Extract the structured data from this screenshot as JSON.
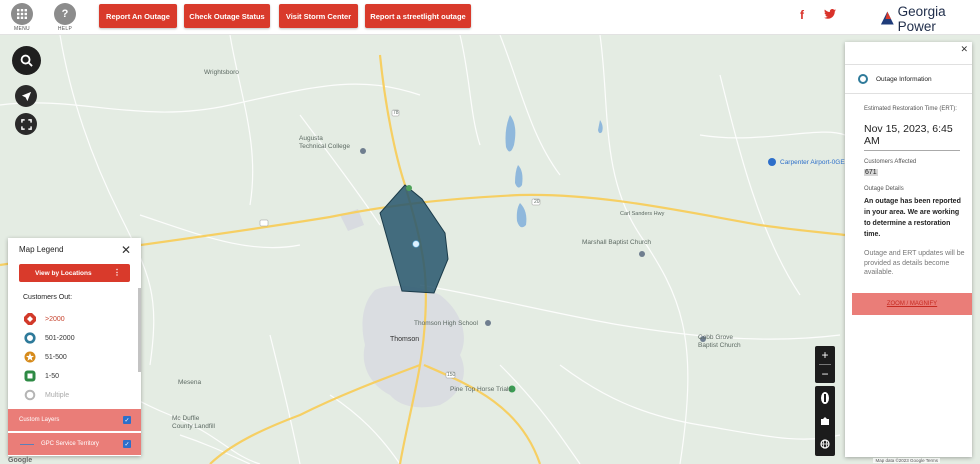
{
  "header": {
    "menu_label": "MENU",
    "help_label": "HELP",
    "buttons": [
      "Report An Outage",
      "Check Outage Status",
      "Visit Storm Center",
      "Report a streetlight outage"
    ],
    "social": [
      "f",
      "t"
    ],
    "brand": "Georgia Power",
    "brand_color": "#1f2d4a",
    "accent": "#d93a2b"
  },
  "map": {
    "labels": {
      "wrightsboro": "Wrightsboro",
      "augusta_tech": "Augusta\nTechnical College",
      "carpenter": "Carpenter Airport-0GE",
      "carl_sanders": "Carl Sanders Hwy",
      "marshall": "Marshall Baptist Church",
      "thomson_hs": "Thomson High School",
      "thomson": "Thomson",
      "pine_top": "Pine Top Horse Trials",
      "cobb_grove": "Cobb Grove\nBaptist Church",
      "mesena": "Mesena",
      "mcduffie": "Mc Duffie\nCounty Landfill",
      "hwy_78": "78",
      "hwy_20": "20",
      "hwy_150": "150"
    },
    "outage_color": "#2c5a70"
  },
  "legend": {
    "title": "Map Legend",
    "close": "✕",
    "view_button": "View by Locations",
    "customers_out": "Customers Out:",
    "items": [
      {
        "label": ">2000",
        "icon": "red-octagon-icon",
        "color": "#d23a2a"
      },
      {
        "label": "501-2000",
        "icon": "blue-ring-icon",
        "color": "#2e7a9a"
      },
      {
        "label": "51-500",
        "icon": "orange-star-icon",
        "color": "#d68a1a"
      },
      {
        "label": "1-50",
        "icon": "green-square-icon",
        "color": "#2e8a44"
      },
      {
        "label": "Multiple",
        "icon": "grey-ring-icon",
        "color": "#b5b5b5"
      }
    ],
    "custom_layers": "Custom Layers",
    "gpc_territory": "GPC Service Territory"
  },
  "panel": {
    "close": "✕",
    "header": "Outage Information",
    "ert_label": "Estimated Restoration Time (ERT):",
    "ert_value": "Nov 15, 2023, 6:45 AM",
    "affected_label": "Customers Affected",
    "affected_value": "671",
    "details_label": "Outage Details",
    "details_bold": "An outage has been reported in your area. We are working to determine a restoration time.",
    "details_note": "Outage and ERT updates will be provided as details become available.",
    "zoom_link": "ZOOM / MAGNIFY"
  },
  "zoom": {
    "plus": "+",
    "minus": "−"
  },
  "footer": {
    "google": "Google",
    "copyright": "Map data ©2023 Google  Terms"
  }
}
